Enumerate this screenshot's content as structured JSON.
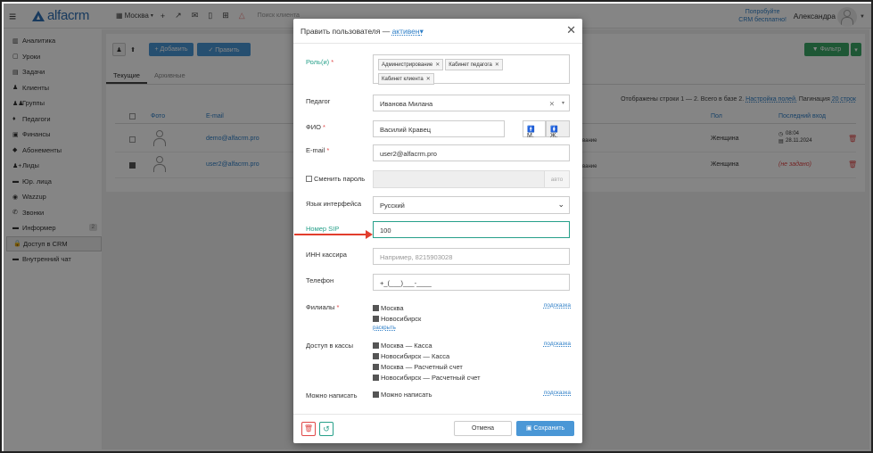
{
  "topbar": {
    "city": "Москва",
    "search_placeholder": "Поиск клиента",
    "try_line1": "Попробуйте",
    "try_line2": "CRM бесплатно!",
    "user_name": "Александра"
  },
  "logo": {
    "text": "alfacrm"
  },
  "sidebar": {
    "items": [
      {
        "label": "Аналитика",
        "icon": "chart-icon"
      },
      {
        "label": "Уроки",
        "icon": "calendar-icon"
      },
      {
        "label": "Задачи",
        "icon": "tasks-icon"
      },
      {
        "label": "Клиенты",
        "icon": "user-icon"
      },
      {
        "label": "Группы",
        "icon": "users-icon"
      },
      {
        "label": "Педагоги",
        "icon": "graduation-icon"
      },
      {
        "label": "Финансы",
        "icon": "money-icon"
      },
      {
        "label": "Абонементы",
        "icon": "tag-icon"
      },
      {
        "label": "Лиды",
        "icon": "lead-icon"
      },
      {
        "label": "Юр. лица",
        "icon": "briefcase-icon"
      },
      {
        "label": "Wazzup",
        "icon": "whatsapp-icon"
      },
      {
        "label": "Звонки",
        "icon": "phone-icon"
      },
      {
        "label": "Информер",
        "icon": "informer-icon",
        "badge": "2"
      },
      {
        "label": "Доступ в CRM",
        "icon": "lock-icon",
        "active": true
      },
      {
        "label": "Внутренний чат",
        "icon": "chat-icon"
      }
    ]
  },
  "toolbar": {
    "add_label": "+ Добавить",
    "edit_label": "✓ Править",
    "filter_label": "▼ Фильтр"
  },
  "tabs": {
    "current": "Текущие",
    "archive": "Архивные"
  },
  "table": {
    "info": "Отображены строки 1 — 2. Всего в базе 2.",
    "settings_link": "Настройка полей.",
    "pagination_label": "Пагинация",
    "pagination_value": "20 строк",
    "headers": {
      "photo": "Фото",
      "email": "E-mail",
      "gender": "Пол",
      "last_login": "Последний вход"
    },
    "rows": [
      {
        "email": "demo@alfacrm.pro",
        "gender": "Женщина",
        "login_time": "08:04",
        "login_date": "28.11.2024",
        "role_tail": "вание"
      },
      {
        "email": "user2@alfacrm.pro",
        "gender": "Женщина",
        "login_time": "(не задано)",
        "login_date": "",
        "role_tail": "вание"
      }
    ]
  },
  "modal": {
    "title": "Править пользователя —",
    "status": "активен",
    "roles_label": "Роль(и)",
    "roles": [
      "Администрирование",
      "Кабинет педагога",
      "Кабинет клиента"
    ],
    "teacher_label": "Педагог",
    "teacher_value": "Иванова Милана",
    "fio_label": "ФИО",
    "fio_value": "Василий Кравец",
    "gender_m": "М.",
    "gender_f": "Ж.",
    "email_label": "E-mail",
    "email_value": "user2@alfacrm.pro",
    "change_pw_label": "Сменить пароль",
    "pw_gen": "авто",
    "lang_label": "Язык интерфейса",
    "lang_value": "Русский",
    "sip_label": "Номер SIP",
    "sip_value": "100",
    "inn_label": "ИНН кассира",
    "inn_placeholder": "Например, 8215903028",
    "phone_label": "Телефон",
    "phone_value": "+_(___)___-____",
    "branches_label": "Филиалы",
    "branches": [
      "Москва",
      "Новосибирск"
    ],
    "expand_link": "раскрыть",
    "hint": "подсказка",
    "cash_label": "Доступ в кассы",
    "cash": [
      "Москва — Касса",
      "Новосибирск — Касса",
      "Москва — Расчетный счет",
      "Новосибирск — Расчетный счет"
    ],
    "write_label": "Можно написать",
    "write_value": "Можно написать",
    "cancel_label": "Отмена",
    "save_label": "Сохранить"
  },
  "colors": {
    "accent": "#2f7fc7",
    "save": "#4a97d6",
    "filter": "#3aa766",
    "arrow": "#e23d2d",
    "required": "#e04848",
    "sip": "#27a08a"
  }
}
